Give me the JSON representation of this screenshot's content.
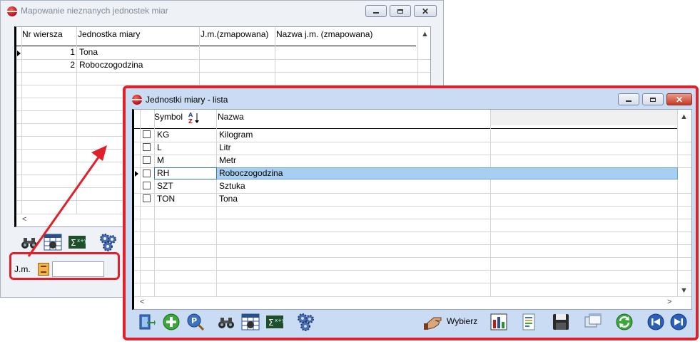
{
  "back_window": {
    "title": "Mapowanie nieznanych jednostek miar",
    "columns": [
      "Nr wiersza",
      "Jednostka miary",
      "J.m.(zmapowana)",
      "Nazwa j.m. (zmapowana)"
    ],
    "rows": [
      {
        "nr": "1",
        "unit": "Tona",
        "mapped": "",
        "mapped_name": ""
      },
      {
        "nr": "2",
        "unit": "Roboczogodzina",
        "mapped": "",
        "mapped_name": ""
      }
    ],
    "jm_label": "J.m.",
    "jm_value": ""
  },
  "front_window": {
    "title": "Jednostki miary - lista",
    "columns": [
      "Symbol",
      "Nazwa"
    ],
    "rows": [
      {
        "symbol": "KG",
        "name": "Kilogram"
      },
      {
        "symbol": "L",
        "name": "Litr"
      },
      {
        "symbol": "M",
        "name": "Metr"
      },
      {
        "symbol": "RH",
        "name": "Roboczogodzina"
      },
      {
        "symbol": "SZT",
        "name": "Sztuka"
      },
      {
        "symbol": "TON",
        "name": "Tona"
      }
    ],
    "selected_index": 3,
    "select_label": "Wybierz"
  },
  "colors": {
    "highlight": "#e0202a",
    "selected_row": "#a8cff1",
    "front_frame": "#c9dcf3",
    "back_frame": "#eef2f7"
  },
  "icons": [
    "binoculars-icon",
    "table-filter-icon",
    "sum-icon",
    "gears-icon",
    "exit-icon",
    "add-icon",
    "preview-icon",
    "hand-select-icon",
    "chart-icon",
    "document-icon",
    "save-icon",
    "copy-icon",
    "refresh-icon",
    "nav-prev-icon",
    "nav-next-icon",
    "sort-az-icon"
  ]
}
